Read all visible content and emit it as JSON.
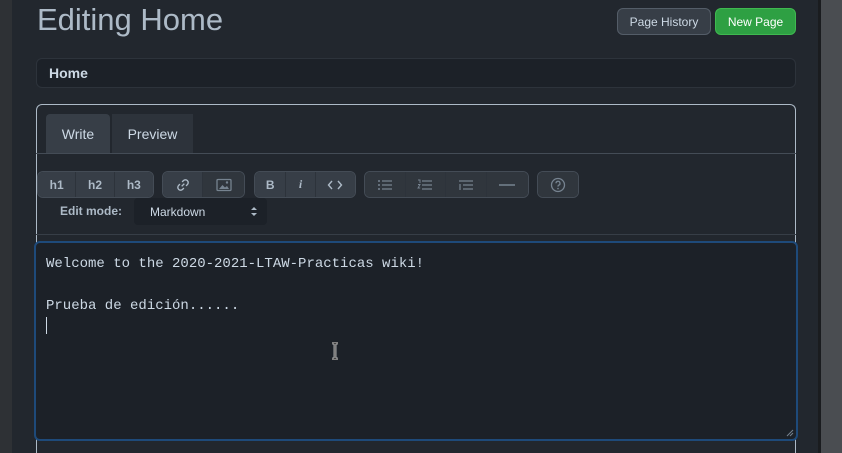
{
  "header": {
    "title": "Editing Home",
    "page_history_label": "Page History",
    "new_page_label": "New Page"
  },
  "page_title_field": {
    "value": "Home"
  },
  "tabs": [
    {
      "label": "Write",
      "active": true
    },
    {
      "label": "Preview",
      "active": false
    }
  ],
  "toolbar": {
    "headers": [
      "h1",
      "h2",
      "h3"
    ],
    "bold_label": "B",
    "italic_label": "i",
    "icons": [
      "link-icon",
      "image-icon",
      "code-icon",
      "unordered-list-icon",
      "ordered-list-icon",
      "task-list-icon",
      "horizontal-rule-icon",
      "help-icon"
    ]
  },
  "edit_mode": {
    "label": "Edit mode:",
    "selected": "Markdown"
  },
  "content": {
    "lines": [
      "Welcome to the 2020-2021-LTAW-Practicas wiki!",
      "",
      "Prueba de edición......",
      ""
    ]
  },
  "colors": {
    "background": "#22272e",
    "new_page_button": "#2ea043",
    "textarea_focus_border": "#1e4a7a"
  }
}
